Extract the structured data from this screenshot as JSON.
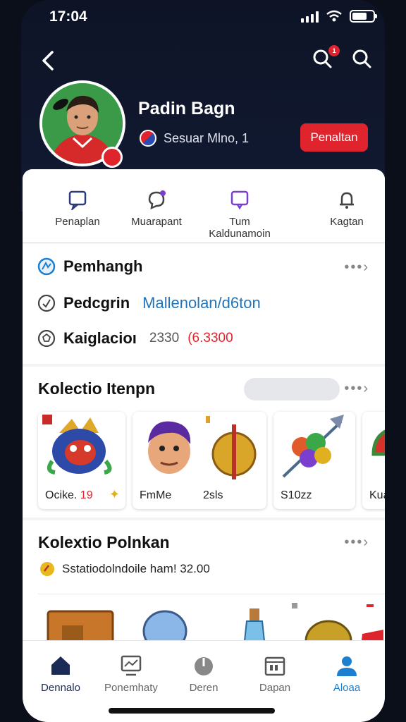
{
  "status_bar": {
    "time": "17:04"
  },
  "profile": {
    "name": "Padin Bagn",
    "subtitle": "Sesuar Mlno, 1",
    "follow_label": "Penaltan",
    "notification_count": "1"
  },
  "quick_actions": [
    {
      "label": "Penaplan",
      "icon": "chat-box-icon"
    },
    {
      "label": "Muarapant",
      "icon": "badge-chat-icon"
    },
    {
      "label": "Tum Kaldunamoin",
      "icon": "message-square-icon"
    },
    {
      "label": "Kagtan",
      "icon": "bell-icon"
    }
  ],
  "info": {
    "row1": {
      "label": "Pemhangh"
    },
    "row2": {
      "label": "Pedcgrin",
      "value": "Mallenolan/d6ton"
    },
    "row3": {
      "label": "Kaiglacioı",
      "value_gray": "2330",
      "value_red": "(6.3300"
    }
  },
  "collection1": {
    "title": "Kolectio Itenpn",
    "tiles": [
      {
        "label": "Ocike.",
        "number": "19"
      },
      {
        "label": "FmMe",
        "extra": "2sls"
      },
      {
        "label": "S10zz"
      },
      {
        "label": "Kuat"
      }
    ]
  },
  "collection2": {
    "title": "Kolextio Polnkan",
    "subtitle": "Sstatiodolndoile ham! 32.00"
  },
  "bottom_nav": [
    {
      "label": "Dennalo",
      "icon": "home-icon"
    },
    {
      "label": "Ponemhaty",
      "icon": "chart-icon"
    },
    {
      "label": "Deren",
      "icon": "power-icon"
    },
    {
      "label": "Dapan",
      "icon": "calendar-icon"
    },
    {
      "label": "Aloaa",
      "icon": "person-icon"
    }
  ],
  "colors": {
    "accent_red": "#e0242e",
    "accent_blue": "#1d7fcf",
    "header_bg": "#0e1426"
  }
}
